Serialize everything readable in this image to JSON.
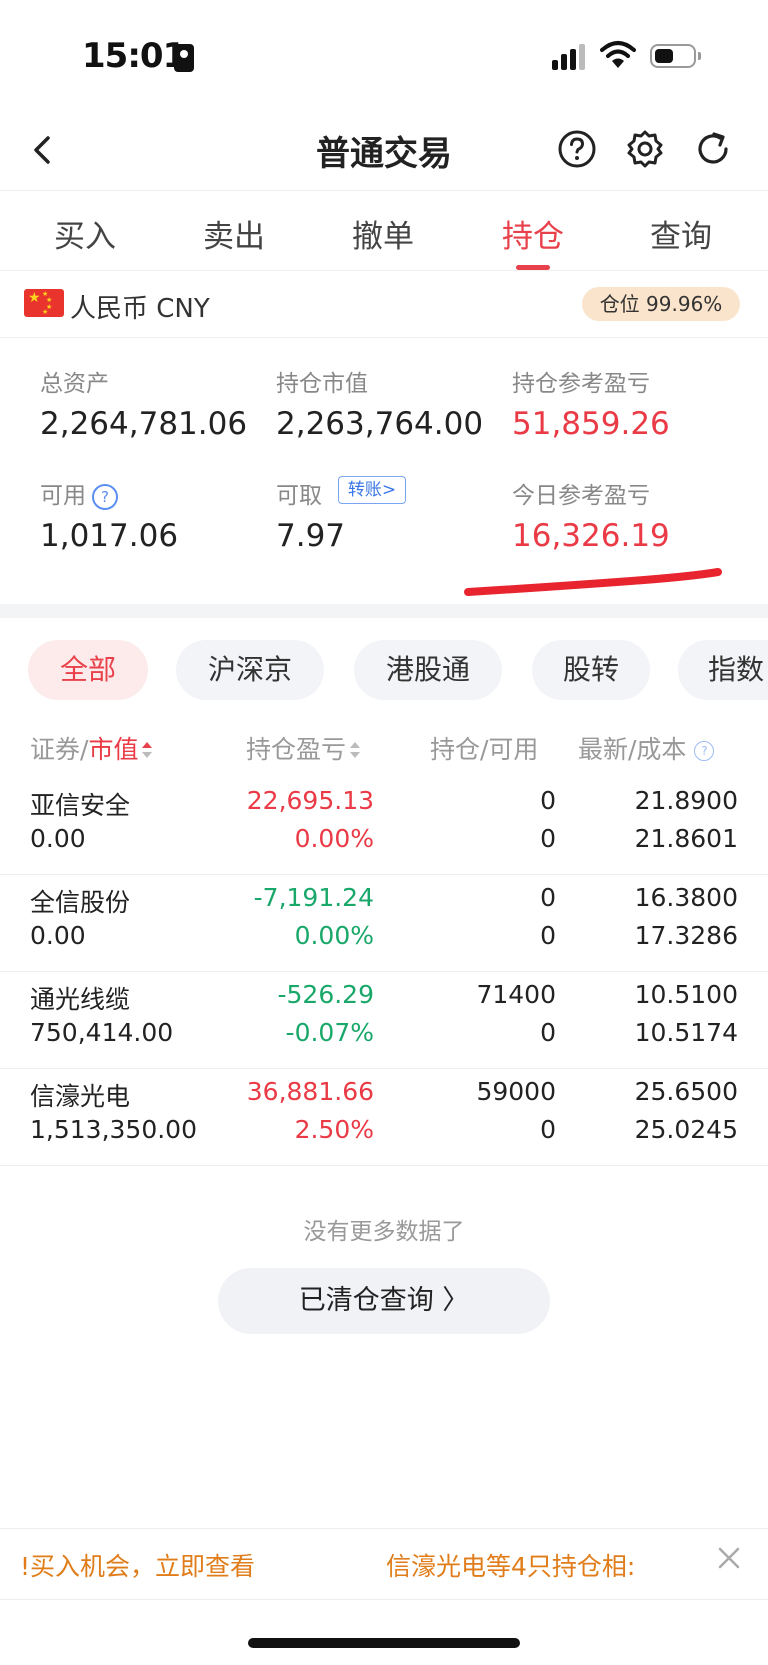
{
  "status_bar": {
    "time": "15:01"
  },
  "nav": {
    "title": "普通交易"
  },
  "tabs": [
    "买入",
    "卖出",
    "撤单",
    "持仓",
    "查询"
  ],
  "account": {
    "currency": "人民币 CNY",
    "position_ratio": "仓位 99.96%",
    "metrics": {
      "total_assets_label": "总资产",
      "total_assets": "2,264,781.06",
      "market_value_label": "持仓市值",
      "market_value": "2,263,764.00",
      "position_pl_label": "持仓参考盈亏",
      "position_pl": "51,859.26",
      "available_label": "可用",
      "available": "1,017.06",
      "withdrawable_label": "可取",
      "withdrawable": "7.97",
      "transfer_label": "转账>",
      "today_pl_label": "今日参考盈亏",
      "today_pl": "16,326.19"
    }
  },
  "filters": [
    "全部",
    "沪深京",
    "港股通",
    "股转",
    "指数"
  ],
  "table": {
    "headers": {
      "col1_a": "证券",
      "col1_sep": "/",
      "col1_b": "市值",
      "col2": "持仓盈亏",
      "col3": "持仓/可用",
      "col4": "最新/成本"
    },
    "rows": [
      {
        "name": "亚信安全",
        "market_value": "0.00",
        "pl": "22,695.13",
        "pl_pct": "0.00%",
        "position": "0",
        "available": "0",
        "latest": "21.8900",
        "cost": "21.8601",
        "pl_color": "red",
        "pct_color": "red"
      },
      {
        "name": "全信股份",
        "market_value": "0.00",
        "pl": "-7,191.24",
        "pl_pct": "0.00%",
        "position": "0",
        "available": "0",
        "latest": "16.3800",
        "cost": "17.3286",
        "pl_color": "green",
        "pct_color": "green"
      },
      {
        "name": "通光线缆",
        "market_value": "750,414.00",
        "pl": "-526.29",
        "pl_pct": "-0.07%",
        "position": "71400",
        "available": "0",
        "latest": "10.5100",
        "cost": "10.5174",
        "pl_color": "green",
        "pct_color": "green"
      },
      {
        "name": "信濠光电",
        "market_value": "1,513,350.00",
        "pl": "36,881.66",
        "pl_pct": "2.50%",
        "position": "59000",
        "available": "0",
        "latest": "25.6500",
        "cost": "25.0245",
        "pl_color": "red",
        "pct_color": "red"
      }
    ]
  },
  "footer": {
    "no_more": "没有更多数据了",
    "closed_query": "已清仓查询 〉"
  },
  "banner": {
    "text1": "!买入机会，立即查看",
    "text2": "信濠光电等4只持仓相:"
  },
  "colors": {
    "accent_red": "#e8414b",
    "profit_red": "#ea3a46",
    "loss_green": "#1aa86a",
    "badge_bg": "#fbe4cc",
    "banner_orange": "#e07d1a"
  }
}
